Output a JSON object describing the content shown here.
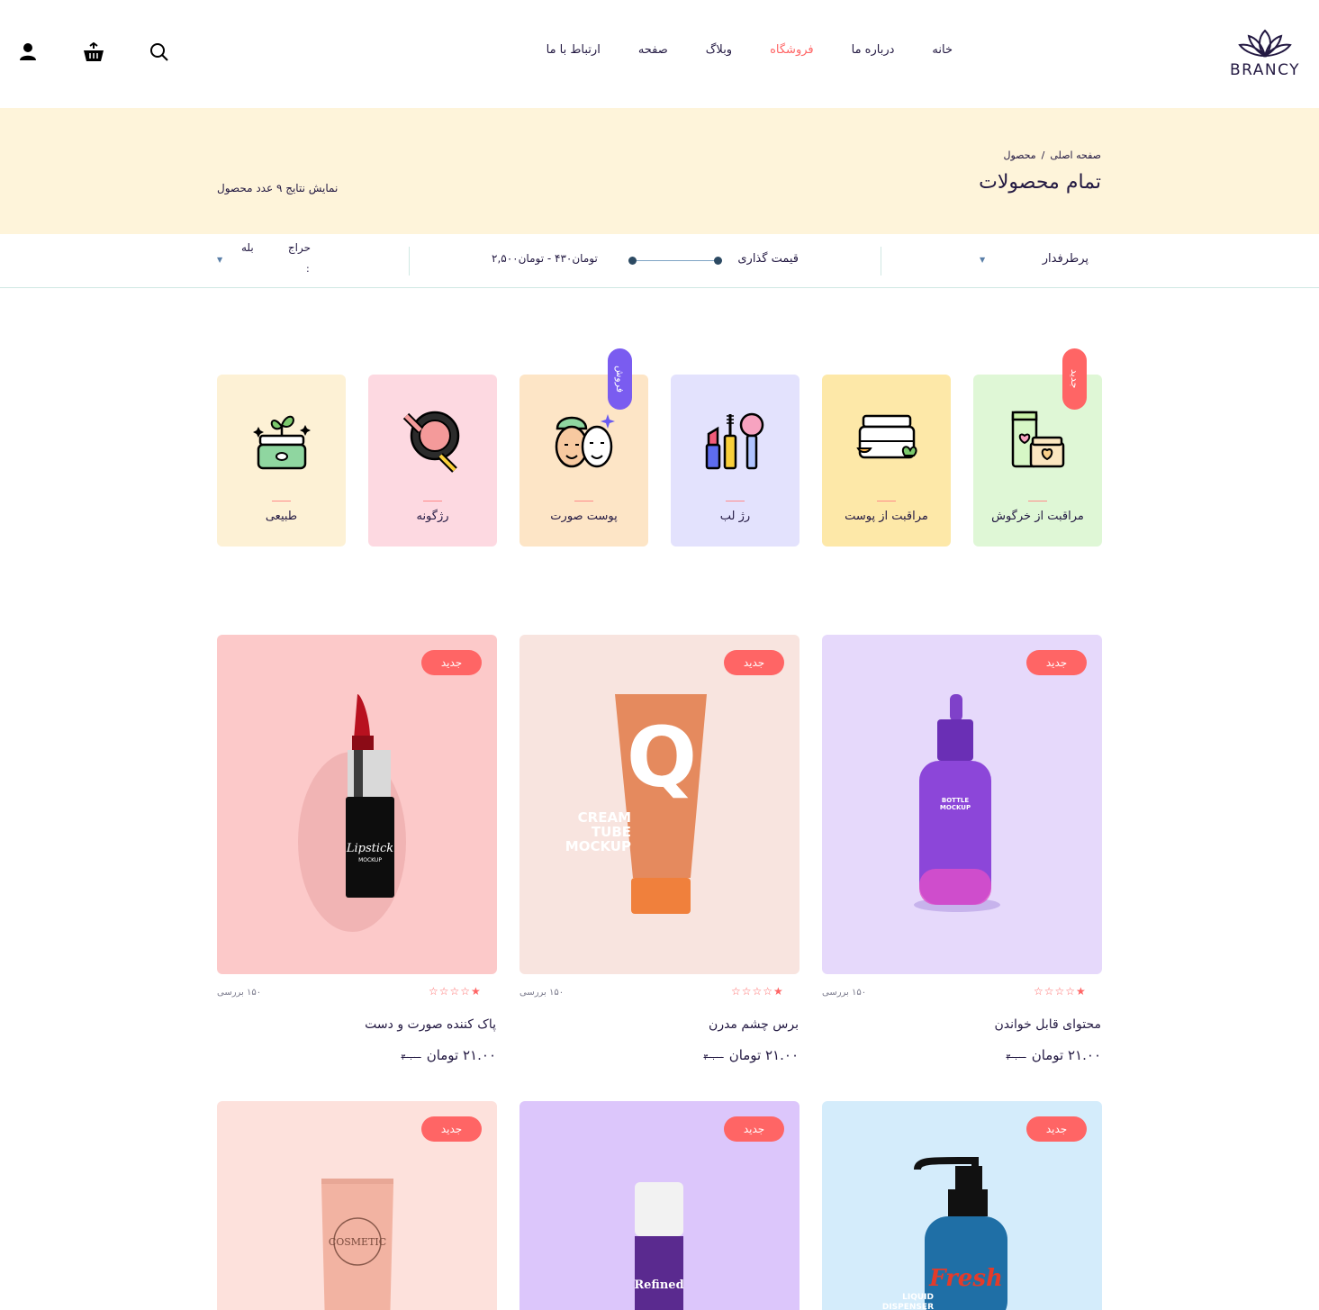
{
  "brand": {
    "logo_text": "BRANCY"
  },
  "nav": {
    "items": [
      {
        "label": "خانه",
        "active": false
      },
      {
        "label": "درباره ما",
        "active": false
      },
      {
        "label": "فروشگاه",
        "active": true
      },
      {
        "label": "وبلاگ",
        "active": false
      },
      {
        "label": "صفحه",
        "active": false
      },
      {
        "label": "ارتباط با ما",
        "active": false
      }
    ],
    "icons": [
      "search-icon",
      "basket-icon",
      "user-icon"
    ]
  },
  "page_header": {
    "breadcrumb_home": "صفحه اصلی",
    "breadcrumb_separator": "/",
    "breadcrumb_current": "محصول",
    "title": "تمام محصولات",
    "results_text": "نمایش نتایج ۹ عدد محصول"
  },
  "filters": {
    "sort_value": "پرطرفدار",
    "price_label": "قیمت گذاری",
    "price_value": "تومان۴۳۰ - تومان۲,۵۰۰",
    "sale_label": "حراج",
    "sale_colon": ":",
    "sale_value": "بله"
  },
  "categories": [
    {
      "label": "مراقبت از خرگوش",
      "bg": "#dff7d6",
      "icon": "rabbit-care-icon",
      "badge": "جدید",
      "badge_color": "#ff6565"
    },
    {
      "label": "مراقبت از پوست",
      "bg": "#fde8a8",
      "icon": "skin-care-jar-icon",
      "badge": "",
      "badge_color": ""
    },
    {
      "label": "رژ لب",
      "bg": "#e3e2fd",
      "icon": "lipstick-set-icon",
      "badge": "",
      "badge_color": ""
    },
    {
      "label": "پوست صورت",
      "bg": "#fde5c6",
      "icon": "face-mask-icon",
      "badge": "فروش",
      "badge_color": "#7a5cf0"
    },
    {
      "label": "رژگونه",
      "bg": "#fdd9e1",
      "icon": "blush-compact-icon",
      "badge": "",
      "badge_color": ""
    },
    {
      "label": "طبیعی",
      "bg": "#fdf1d5",
      "icon": "natural-jar-icon",
      "badge": "",
      "badge_color": ""
    }
  ],
  "products": [
    {
      "name": "محتوای قابل خواندن",
      "price": "۲۱.۰۰ تومان",
      "old_price": "۳۰.۰۰",
      "reviews": "۱۵۰ بررسی",
      "badge": "جدید",
      "bg": "#e6d9fb",
      "image": "bottle-mockup",
      "image_text": [
        "BOTTLE",
        "MOCKUP"
      ],
      "rating": 0.5
    },
    {
      "name": "برس چشم مدرن",
      "price": "۲۱.۰۰ تومان",
      "old_price": "۳۰.۰۰",
      "reviews": "۱۵۰ بررسی",
      "badge": "جدید",
      "bg": "#f8e4df",
      "image": "cream-tube-mockup",
      "image_text": [
        "Q",
        "CREAM",
        "TUBE",
        "MOCKUP"
      ],
      "rating": 0.5
    },
    {
      "name": "پاک کننده صورت و دست",
      "price": "۲۱.۰۰ تومان",
      "old_price": "۳۰.۰۰",
      "reviews": "۱۵۰ بررسی",
      "badge": "جدید",
      "bg": "#fcc9c9",
      "image": "lipstick-mockup",
      "image_text": [
        "Lipstick",
        "MOCKUP"
      ],
      "rating": 0.5
    },
    {
      "name": "",
      "price": "",
      "old_price": "",
      "reviews": "",
      "badge": "جدید",
      "bg": "#d4ecfb",
      "image": "liquid-dispenser",
      "image_text": [
        "Fresh",
        "LIQUID",
        "DISPENSER"
      ],
      "rating": null
    },
    {
      "name": "",
      "price": "",
      "old_price": "",
      "reviews": "",
      "badge": "جدید",
      "bg": "#dcc6fb",
      "image": "refined-spray-bottle",
      "image_text": [
        "Refined"
      ],
      "rating": null
    },
    {
      "name": "",
      "price": "",
      "old_price": "",
      "reviews": "",
      "badge": "جدید",
      "bg": "#fde1dc",
      "image": "cosmetic-tube",
      "image_text": [
        "COSMETIC"
      ],
      "rating": null
    }
  ]
}
